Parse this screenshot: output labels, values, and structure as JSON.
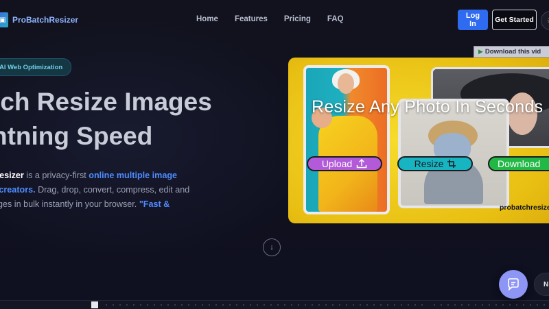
{
  "header": {
    "logo_text": "ProBatchResizer",
    "nav": [
      "Home",
      "Features",
      "Pricing",
      "FAQ"
    ],
    "login_label": "Log In",
    "get_started_label": "Get Started"
  },
  "hero": {
    "badge": "AI Web Optimization",
    "title_line1": "tch Resize Images",
    "title_line2": "htning Speed",
    "desc": {
      "brand": "Resizer",
      "t1": " is a privacy-first ",
      "link1": "online multiple image",
      "link2": "r creators.",
      "t2": " Drag, drop, convert, compress, edit and",
      "t3": "ages in bulk instantly in your browser. ",
      "quote": "\"Fast &"
    }
  },
  "promo": {
    "video_bar": "Download this vid",
    "title": "Resize Any Photo In Seconds",
    "upload_label": "Upload",
    "resize_label": "Resize",
    "download_label": "Download",
    "domain": "probatchresizer"
  },
  "chat": {
    "side_label": "N"
  },
  "colors": {
    "background": "#10111c",
    "accent": "#2f6bf0",
    "link": "#4f8cff",
    "promo_yellow": "#f6dc2c"
  }
}
